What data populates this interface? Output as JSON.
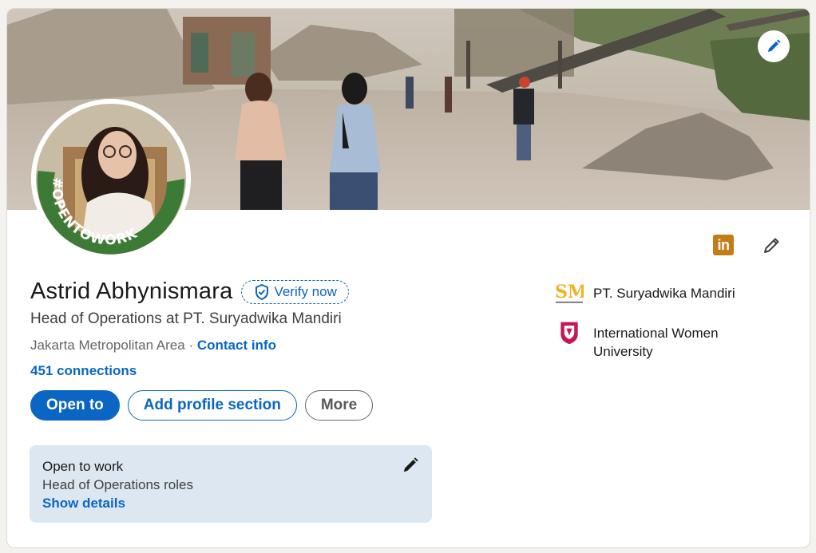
{
  "profile": {
    "name": "Astrid Abhynismara",
    "verify_label": "Verify now",
    "headline": "Head of Operations at PT. Suryadwika Mandiri",
    "location": "Jakarta Metropolitan Area",
    "separator": " · ",
    "contact_label": "Contact info",
    "connections": "451 connections",
    "avatar_frame_text": "#OPENTOWORK"
  },
  "actions": {
    "open_to": "Open to",
    "add_section": "Add profile section",
    "more": "More"
  },
  "open_to_work": {
    "title": "Open to work",
    "roles": "Head of Operations roles",
    "link": "Show details"
  },
  "affiliations": [
    {
      "name": "PT. Suryadwika Mandiri",
      "logo_text": "SM",
      "icon": "company-logo"
    },
    {
      "name": "International Women University",
      "icon": "university-logo"
    }
  ],
  "icons": {
    "banner_edit": "pencil-icon",
    "linkedin": "linkedin-icon",
    "linkedin_text": "in",
    "edit": "pencil-icon",
    "verify": "shield-check-icon"
  },
  "colors": {
    "accent": "#0a66c2",
    "otw_green": "#3d7a35",
    "otw_box": "#dde7f1",
    "linkedin_badge": "#c37d16"
  }
}
